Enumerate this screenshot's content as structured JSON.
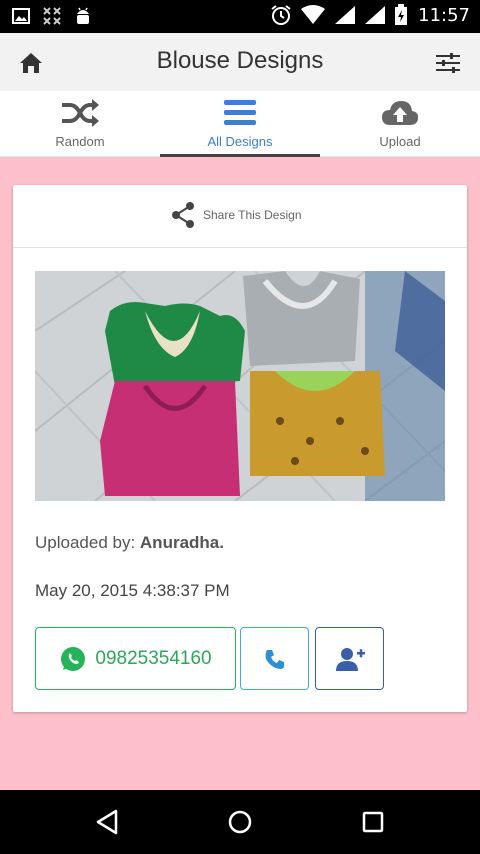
{
  "status_bar": {
    "time": "11:57",
    "icons": [
      "image-icon",
      "apps-icon",
      "android-icon",
      "alarm-icon",
      "wifi-icon",
      "signal-icon",
      "battery-icon"
    ]
  },
  "app_bar": {
    "title": "Blouse Designs",
    "home_icon": "home-icon",
    "settings_icon": "sliders-icon"
  },
  "tabs": [
    {
      "label": "Random",
      "icon": "shuffle-icon",
      "active": false
    },
    {
      "label": "All Designs",
      "icon": "menu-icon",
      "active": true
    },
    {
      "label": "Upload",
      "icon": "cloud-upload-icon",
      "active": false
    }
  ],
  "card": {
    "share_label": "Share This Design",
    "uploaded_prefix": "Uploaded by: ",
    "uploader": "Anuradha.",
    "date": "May 20, 2015 4:38:37 PM",
    "phone": "09825354160"
  },
  "colors": {
    "background": "#fdc0cb",
    "active_tab": "#3b7dd8",
    "whatsapp": "#25b35a",
    "call": "#45a9e6",
    "add_contact": "#3a5fa8"
  },
  "nav_bar": {
    "buttons": [
      "back-icon",
      "home-circle-icon",
      "recents-icon"
    ]
  }
}
